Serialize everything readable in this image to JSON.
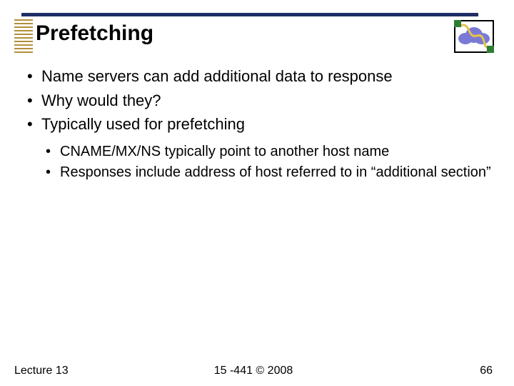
{
  "title": "Prefetching",
  "bullets": {
    "primary": [
      "Name servers can add additional data to response",
      "Why would they?",
      "Typically used for prefetching"
    ],
    "secondary": [
      "CNAME/MX/NS typically point to another host name",
      "Responses include address of host referred to in “additional section”"
    ]
  },
  "footer": {
    "left": "Lecture 13",
    "center": "15 -441  ©  2008",
    "right": "66"
  },
  "logo": {
    "name": "network-cloud-logo"
  }
}
